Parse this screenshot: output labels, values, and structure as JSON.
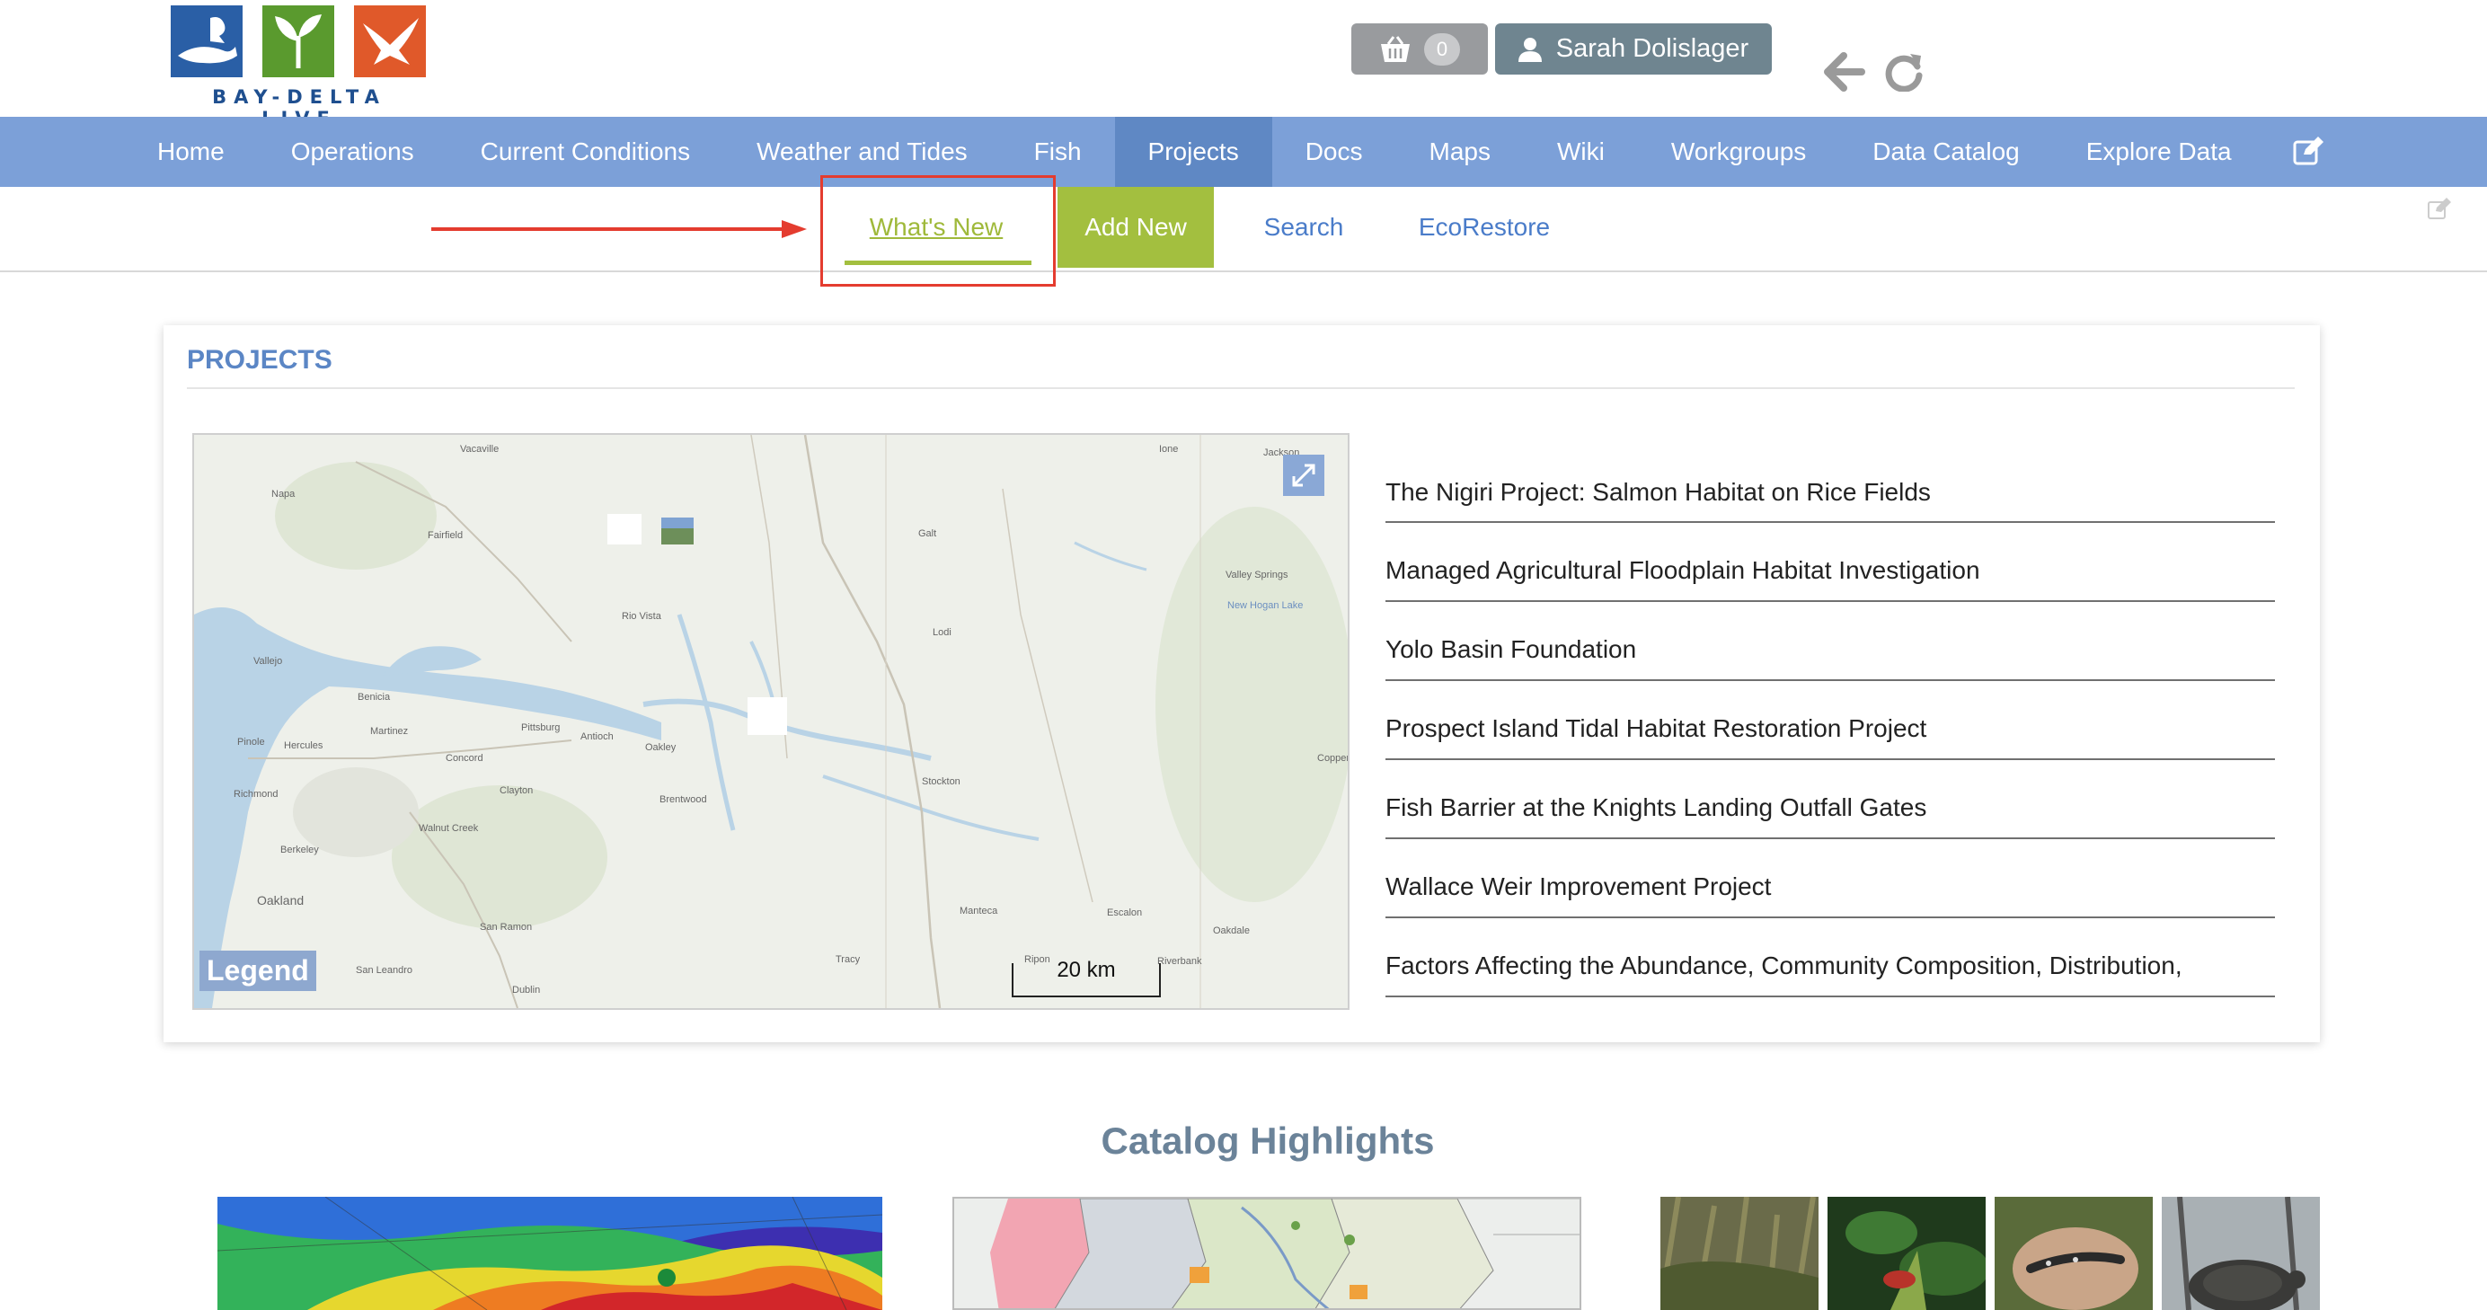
{
  "header": {
    "logo_text": "BAY-DELTA LIVE",
    "cart_count": "0",
    "user_name": "Sarah Dolislager"
  },
  "nav": {
    "items": [
      {
        "label": "Home",
        "active": false
      },
      {
        "label": "Operations",
        "active": false
      },
      {
        "label": "Current Conditions",
        "active": false
      },
      {
        "label": "Weather and Tides",
        "active": false
      },
      {
        "label": "Fish",
        "active": false
      },
      {
        "label": "Projects",
        "active": true
      },
      {
        "label": "Docs",
        "active": false
      },
      {
        "label": "Maps",
        "active": false
      },
      {
        "label": "Wiki",
        "active": false
      },
      {
        "label": "Workgroups",
        "active": false
      },
      {
        "label": "Data Catalog",
        "active": false
      },
      {
        "label": "Explore Data",
        "active": false
      }
    ]
  },
  "subnav": {
    "whats_new": "What's New",
    "add_new": "Add New",
    "search": "Search",
    "ecorestore": "EcoRestore"
  },
  "projects": {
    "title": "PROJECTS",
    "map": {
      "legend": "Legend",
      "scale": "20 km",
      "places": [
        "Vacaville",
        "Napa",
        "Fairfield",
        "Rio Vista",
        "Vallejo",
        "Benicia",
        "Martinez",
        "Pinole",
        "Hercules",
        "Richmond",
        "Pittsburg",
        "Antioch",
        "Oakley",
        "Concord",
        "Clayton",
        "Walnut Creek",
        "Berkeley",
        "Oakland",
        "San Ramon",
        "San Leandro",
        "Dublin",
        "Brentwood",
        "Galt",
        "Lodi",
        "Stockton",
        "Manteca",
        "Escalon",
        "Oakdale",
        "Tracy",
        "Ripon",
        "Riverbank",
        "Valley Springs",
        "New Hogan Lake",
        "Copperopolis",
        "Ione",
        "Jackson"
      ]
    },
    "items": [
      "The Nigiri Project: Salmon Habitat on Rice Fields",
      "Managed Agricultural Floodplain Habitat Investigation",
      "Yolo Basin Foundation",
      "Prospect Island Tidal Habitat Restoration Project",
      "Fish Barrier at the Knights Landing Outfall Gates",
      "Wallace Weir Improvement Project",
      "Factors Affecting the Abundance, Community Composition, Distribution,"
    ]
  },
  "catalog": {
    "title": "Catalog Highlights"
  },
  "colors": {
    "nav_bg": "#7ca0d8",
    "nav_active": "#5f88c4",
    "accent_green": "#a3bf3f",
    "link_blue": "#4a7cc9",
    "highlight_red": "#e43c2f"
  }
}
